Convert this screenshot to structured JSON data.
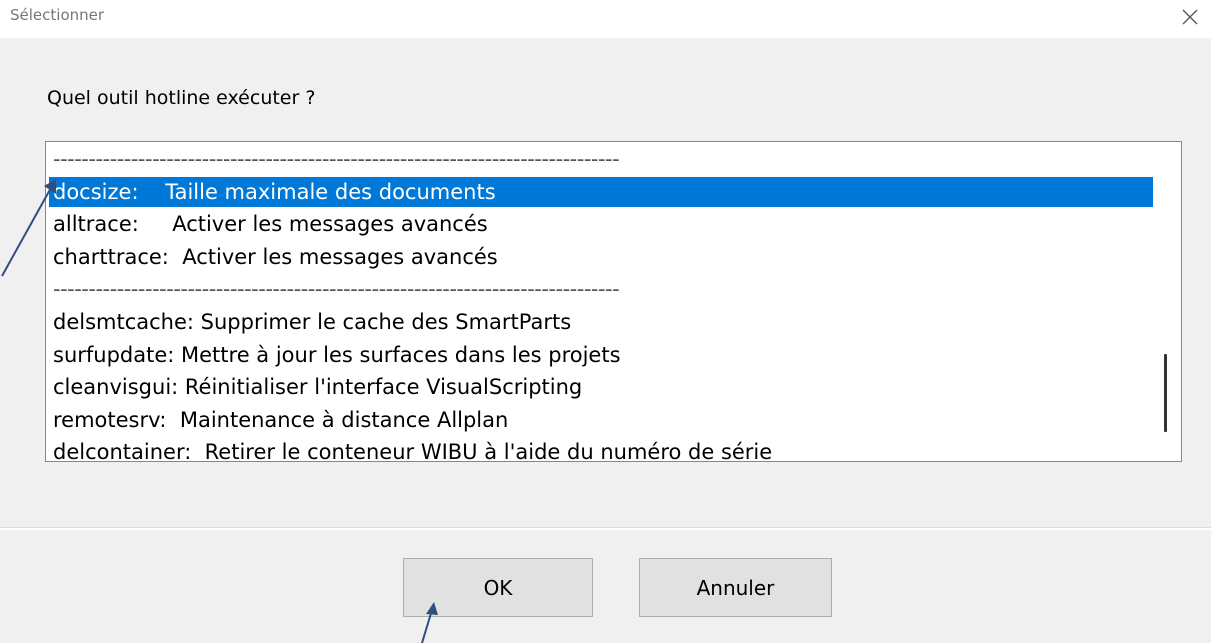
{
  "window": {
    "title": "Sélectionner",
    "close_icon": "close-icon"
  },
  "prompt": "Quel outil hotline exécuter ?",
  "list": {
    "selected_index": 1,
    "items": [
      {
        "text": "--------------------------------------------------------------------------------",
        "separator": true
      },
      {
        "text": "docsize:    Taille maximale des documents",
        "separator": false
      },
      {
        "text": "alltrace:     Activer les messages avancés",
        "separator": false
      },
      {
        "text": "charttrace:  Activer les messages avancés",
        "separator": false
      },
      {
        "text": "--------------------------------------------------------------------------------",
        "separator": true
      },
      {
        "text": "delsmtcache: Supprimer le cache des SmartParts",
        "separator": false
      },
      {
        "text": "surfupdate: Mettre à jour les surfaces dans les projets",
        "separator": false
      },
      {
        "text": "cleanvisgui: Réinitialiser l'interface VisualScripting",
        "separator": false
      },
      {
        "text": "remotesrv:  Maintenance à distance Allplan",
        "separator": false
      },
      {
        "text": "delcontainer:  Retirer le conteneur WIBU à l'aide du numéro de série",
        "separator": false
      }
    ]
  },
  "buttons": {
    "ok": "OK",
    "cancel": "Annuler"
  },
  "colors": {
    "selection": "#0078d7",
    "annotation_arrow": "#2f4f7f"
  }
}
